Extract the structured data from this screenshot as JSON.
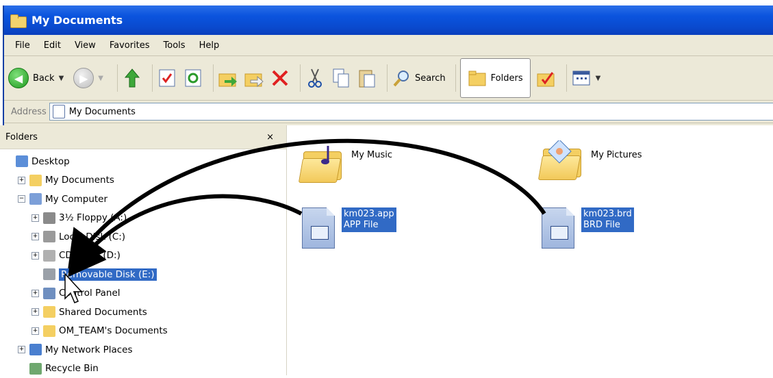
{
  "window": {
    "title": "My Documents"
  },
  "menu": [
    "File",
    "Edit",
    "View",
    "Favorites",
    "Tools",
    "Help"
  ],
  "toolbar": {
    "back_label": "Back",
    "search_label": "Search",
    "folders_label": "Folders"
  },
  "address": {
    "label": "Address",
    "value": "My Documents"
  },
  "folders_pane": {
    "title": "Folders",
    "close": "×",
    "tree": [
      {
        "label": "Desktop",
        "expander": "",
        "indent": 0,
        "icon": "desktop-icon"
      },
      {
        "label": "My Documents",
        "expander": "+",
        "indent": 1,
        "icon": "folder-icon"
      },
      {
        "label": "My Computer",
        "expander": "−",
        "indent": 1,
        "icon": "computer-icon"
      },
      {
        "label": "3½ Floppy (A:)",
        "expander": "+",
        "indent": 2,
        "icon": "floppy-icon"
      },
      {
        "label": "Local Disk (C:)",
        "expander": "+",
        "indent": 2,
        "icon": "harddisk-icon"
      },
      {
        "label": "CD Drive (D:)",
        "expander": "+",
        "indent": 2,
        "icon": "cd-drive-icon"
      },
      {
        "label": "Removable Disk (E:)",
        "expander": "",
        "indent": 2,
        "icon": "removable-disk-icon",
        "selected": true
      },
      {
        "label": "Control Panel",
        "expander": "+",
        "indent": 2,
        "icon": "control-panel-icon"
      },
      {
        "label": "Shared Documents",
        "expander": "+",
        "indent": 2,
        "icon": "folder-icon"
      },
      {
        "label": "OM_TEAM's Documents",
        "expander": "+",
        "indent": 2,
        "icon": "folder-icon"
      },
      {
        "label": "My Network Places",
        "expander": "+",
        "indent": 1,
        "icon": "network-places-icon"
      },
      {
        "label": "Recycle Bin",
        "expander": "",
        "indent": 1,
        "icon": "recycle-bin-icon"
      }
    ]
  },
  "files": [
    {
      "name": "My Music",
      "type": "",
      "icon": "music-folder-icon"
    },
    {
      "name": "My Pictures",
      "type": "",
      "icon": "pictures-folder-icon"
    },
    {
      "name": "km023.app",
      "type": "APP File",
      "icon": "file-icon",
      "selected": true
    },
    {
      "name": "km023.brd",
      "type": "BRD File",
      "icon": "file-icon",
      "selected": true
    }
  ],
  "colors": {
    "titlebar": "#0b54de",
    "selection": "#316ac5",
    "chrome": "#ece9d8",
    "arrow": "#000000"
  }
}
